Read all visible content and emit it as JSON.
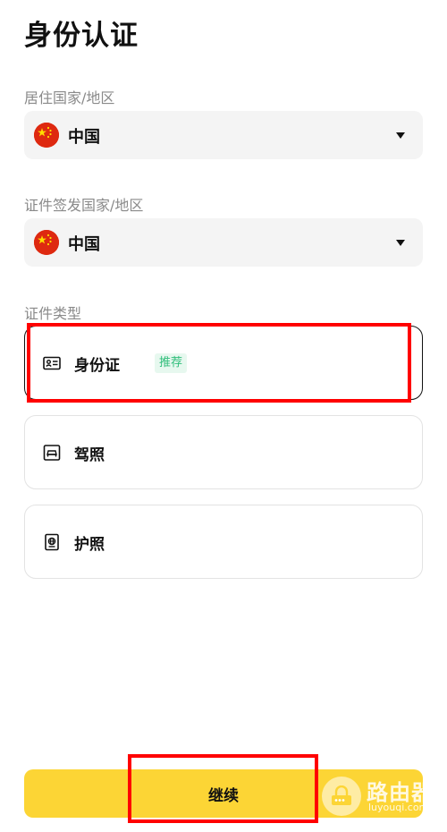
{
  "header": {
    "title": "身份认证"
  },
  "residence": {
    "label": "居住国家/地区",
    "value": "中国",
    "flag_icon": "china-flag"
  },
  "issuing": {
    "label": "证件签发国家/地区",
    "value": "中国",
    "flag_icon": "china-flag"
  },
  "document_type": {
    "label": "证件类型",
    "options": [
      {
        "label": "身份证",
        "badge": "推荐",
        "icon": "id-card-icon",
        "selected": true
      },
      {
        "label": "驾照",
        "icon": "driver-license-icon",
        "selected": false
      },
      {
        "label": "护照",
        "icon": "passport-icon",
        "selected": false
      }
    ]
  },
  "footer": {
    "continue_label": "继续"
  },
  "watermark": {
    "title": "路由器",
    "url": "luyouqi.com"
  },
  "colors": {
    "accent": "#fcd535",
    "badge_text": "#2fbd7a",
    "badge_bg": "#e7f8ef",
    "annotation": "#ff0000"
  }
}
